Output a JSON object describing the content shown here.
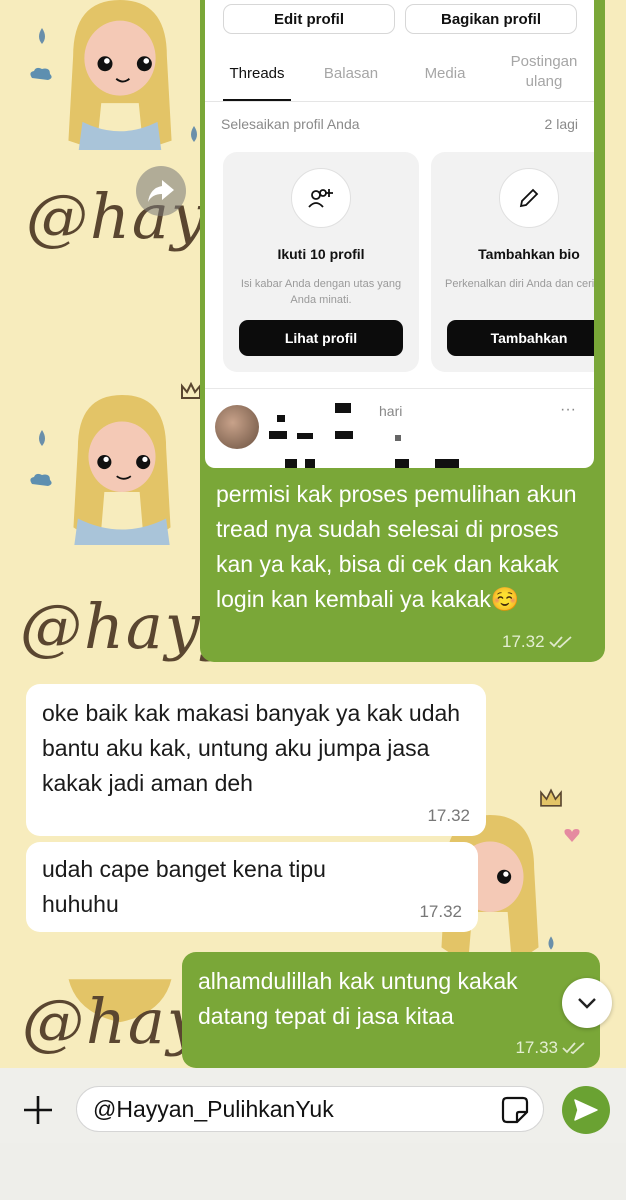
{
  "screenshot": {
    "buttons": {
      "edit": "Edit profil",
      "share": "Bagikan profil"
    },
    "tabs": [
      "Threads",
      "Balasan",
      "Media",
      "Postingan\nulang"
    ],
    "complete_label": "Selesaikan profil Anda",
    "complete_count": "2 lagi",
    "cards": [
      {
        "title": "Ikuti 10 profil",
        "desc": "Isi kabar Anda dengan utas yang Anda minati.",
        "button": "Lihat profil",
        "icon": "add-people-icon"
      },
      {
        "title": "Tambahkan bio",
        "desc": "Perkenalkan diri Anda dan ceritakan apa yang Anda suk",
        "button": "Tambahkan",
        "icon": "pencil-icon"
      }
    ],
    "post_time": "hari",
    "post_more": "···"
  },
  "messages": [
    {
      "dir": "out",
      "text": "permisi kak proses pemulihan akun tread nya sudah selesai di proses kan ya kak, bisa di cek dan kakak login kan kembali ya kakak☺️",
      "time": "17.32"
    },
    {
      "dir": "in",
      "text": "oke baik kak makasi banyak ya kak udah bantu aku kak, untung aku jumpa jasa kakak jadi aman deh",
      "time": "17.32"
    },
    {
      "dir": "in",
      "text": "udah cape banget kena tipu huhuhu",
      "time": "17.32"
    },
    {
      "dir": "out",
      "text": "alhamdulillah kak untung kakak datang tepat di jasa kitaa",
      "time": "17.33"
    }
  ],
  "input": {
    "value": "@Hayyan_PulihkanYuk"
  },
  "wallpaper": {
    "script_text": "@hayyan"
  },
  "colors": {
    "outgoing": "#7aa738",
    "incoming": "#ffffff",
    "wallpaper": "#f7ecbd",
    "send": "#6aa232"
  }
}
